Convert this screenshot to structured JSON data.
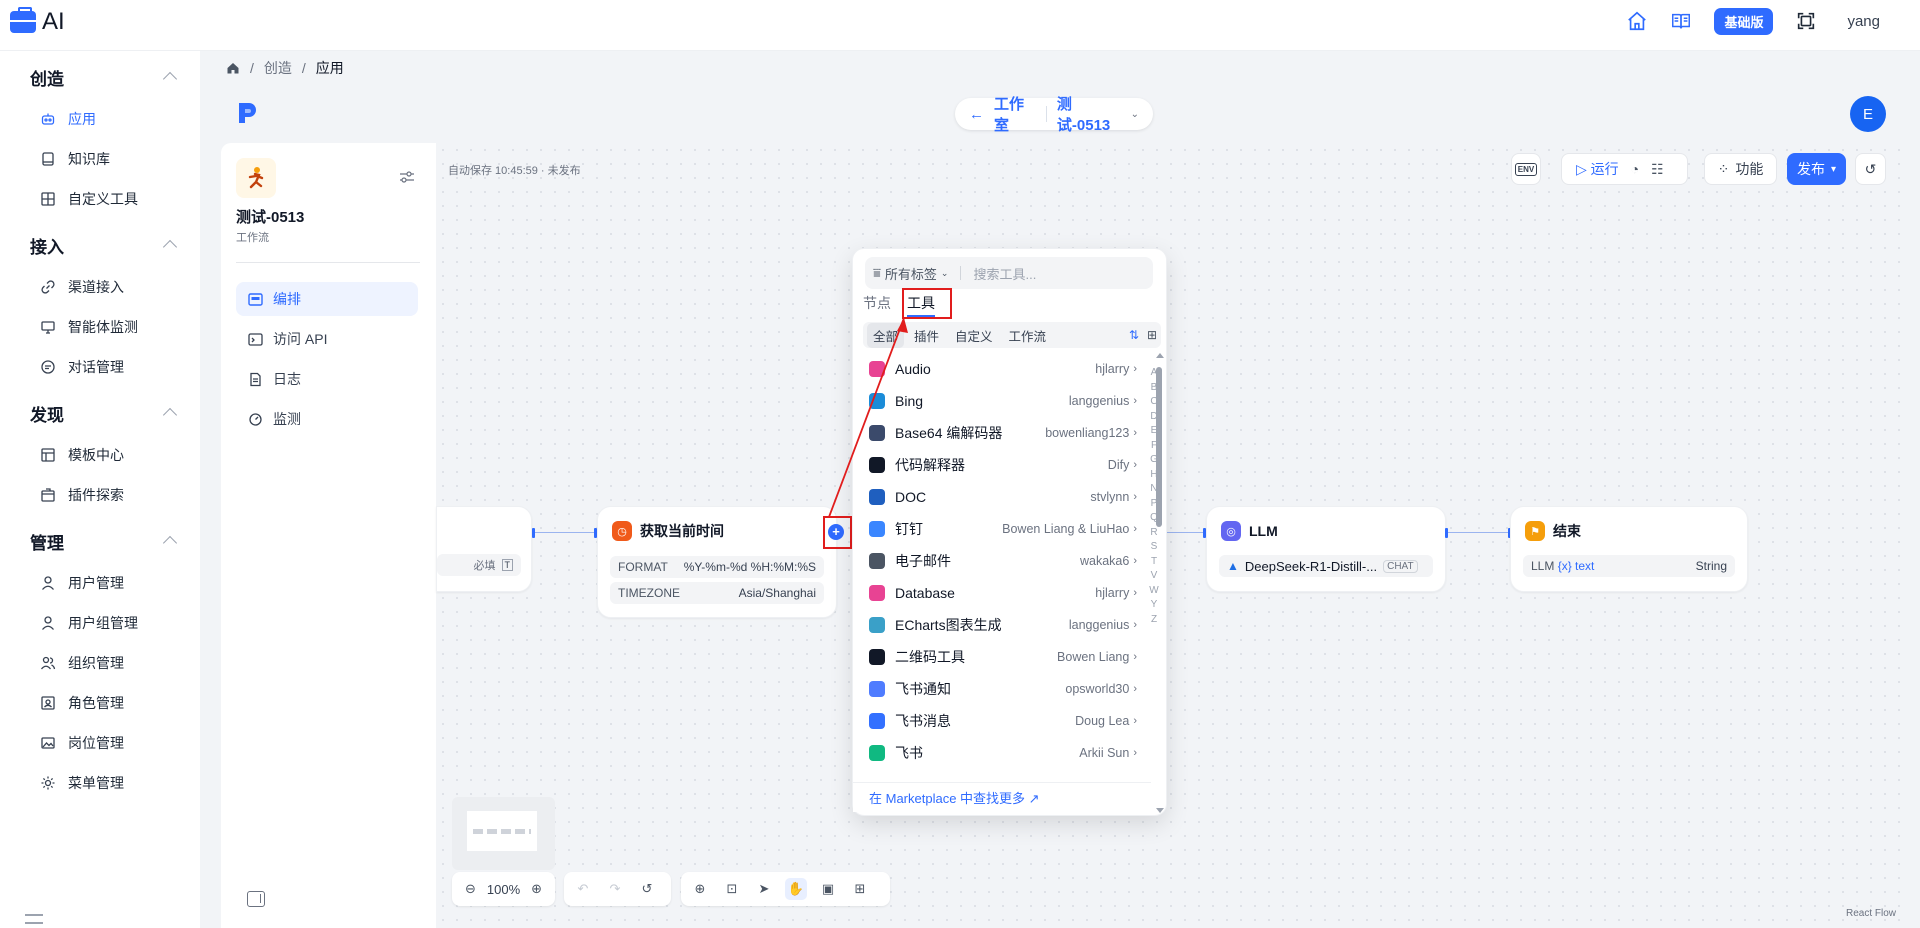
{
  "app": {
    "logo_text": "AI"
  },
  "topbar": {
    "plan_badge": "基础版",
    "username": "yang"
  },
  "sidebar": {
    "groups": [
      {
        "title": "创造",
        "items": [
          {
            "label": "应用"
          },
          {
            "label": "知识库"
          },
          {
            "label": "自定义工具"
          }
        ]
      },
      {
        "title": "接入",
        "items": [
          {
            "label": "渠道接入"
          },
          {
            "label": "智能体监测"
          },
          {
            "label": "对话管理"
          }
        ]
      },
      {
        "title": "发现",
        "items": [
          {
            "label": "模板中心"
          },
          {
            "label": "插件探索"
          }
        ]
      },
      {
        "title": "管理",
        "items": [
          {
            "label": "用户管理"
          },
          {
            "label": "用户组管理"
          },
          {
            "label": "组织管理"
          },
          {
            "label": "角色管理"
          },
          {
            "label": "岗位管理"
          },
          {
            "label": "菜单管理"
          }
        ]
      }
    ]
  },
  "breadcrumb": {
    "items": [
      "创造",
      "应用"
    ]
  },
  "header": {
    "back_label": "工作室",
    "app_name": "测试-0513",
    "avatar_letter": "E"
  },
  "left_panel": {
    "app_name": "测试-0513",
    "app_type": "工作流",
    "items": [
      {
        "label": "编排"
      },
      {
        "label": "访问 API"
      },
      {
        "label": "日志"
      },
      {
        "label": "监测"
      }
    ]
  },
  "canvas": {
    "autosave": "自动保存 10:45:59 · 未发布",
    "toolbar": {
      "env": "ENV",
      "run": "运行",
      "features": "功能",
      "publish": "发布"
    },
    "nodes": {
      "start": {
        "row_required": "必填"
      },
      "get_time": {
        "title": "获取当前时间",
        "rows": [
          {
            "k": "FORMAT",
            "v": "%Y-%m-%d %H:%M:%S"
          },
          {
            "k": "TIMEZONE",
            "v": "Asia/Shanghai"
          }
        ]
      },
      "llm": {
        "title": "LLM",
        "model": "DeepSeek-R1-Distill-...",
        "mode": "CHAT"
      },
      "end": {
        "title": "结束",
        "var_source": "LLM",
        "var_name": "{x} text",
        "var_type": "String"
      }
    },
    "zoom": "100%",
    "attribution": "React Flow"
  },
  "picker": {
    "tag_filter": "所有标签",
    "search_placeholder": "搜索工具...",
    "tabs": [
      "节点",
      "工具"
    ],
    "filters": [
      "全部",
      "插件",
      "自定义",
      "工作流"
    ],
    "tools": [
      {
        "name": "Audio",
        "author": "hjlarry",
        "color": "#e84393"
      },
      {
        "name": "Bing",
        "author": "langgenius",
        "color": "#1b8cd8"
      },
      {
        "name": "Base64 编解码器",
        "author": "bowenliang123",
        "color": "#3b4a6b"
      },
      {
        "name": "代码解释器",
        "author": "Dify",
        "color": "#111827"
      },
      {
        "name": "DOC",
        "author": "stvlynn",
        "color": "#1f5fbf"
      },
      {
        "name": "钉钉",
        "author": "Bowen Liang & LiuHao",
        "color": "#3a86ff"
      },
      {
        "name": "电子邮件",
        "author": "wakaka6",
        "color": "#4b5563"
      },
      {
        "name": "Database",
        "author": "hjlarry",
        "color": "#e84393"
      },
      {
        "name": "ECharts图表生成",
        "author": "langgenius",
        "color": "#3aa0c8"
      },
      {
        "name": "二维码工具",
        "author": "Bowen Liang",
        "color": "#111827"
      },
      {
        "name": "飞书通知",
        "author": "opsworld30",
        "color": "#4f7cff"
      },
      {
        "name": "飞书消息",
        "author": "Doug Lea",
        "color": "#3370ff"
      },
      {
        "name": "飞书",
        "author": "Arkii Sun",
        "color": "#10b981"
      }
    ],
    "alphabet": [
      "A",
      "B",
      "C",
      "D",
      "E",
      "F",
      "G",
      "H",
      "N",
      "P",
      "Q",
      "R",
      "S",
      "T",
      "V",
      "W",
      "Y",
      "Z"
    ],
    "marketplace_link": "在 Marketplace 中查找更多 ↗"
  },
  "colors": {
    "accent": "#2f6bff",
    "highlight": "#e11d1d"
  }
}
